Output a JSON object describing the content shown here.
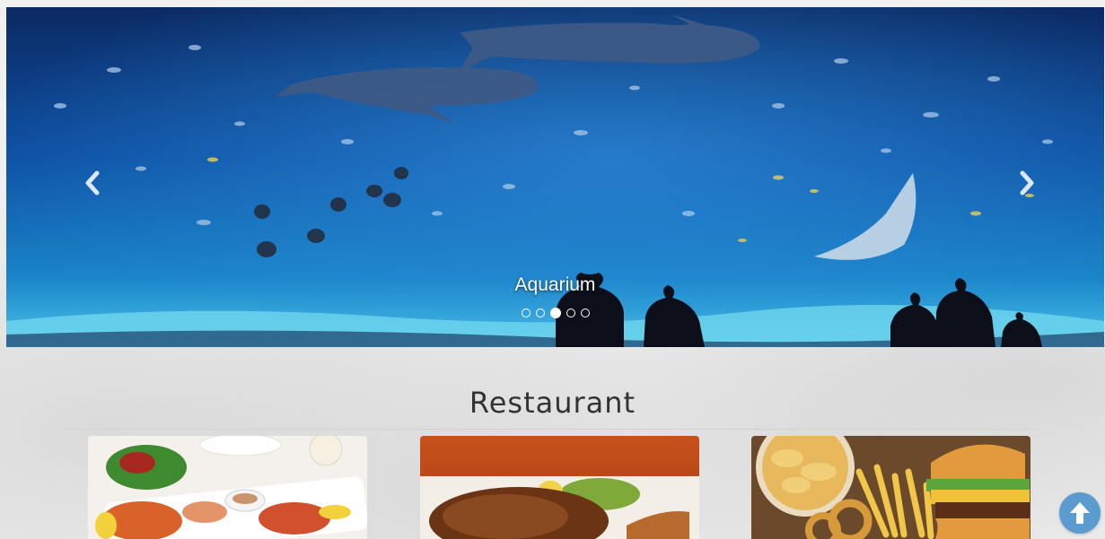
{
  "carousel": {
    "caption": "Aquarium",
    "indicator_count": 5,
    "active_index": 2,
    "prev_icon": "chevron-left-icon",
    "next_icon": "chevron-right-icon"
  },
  "section": {
    "title": "Restaurant"
  },
  "cards": [
    {
      "image": "seafood-platter-image"
    },
    {
      "image": "roast-meat-plate-image"
    },
    {
      "image": "burger-and-fries-image"
    }
  ],
  "back_to_top": {
    "icon": "arrow-up-icon",
    "color": "#5b9bd0"
  },
  "colors": {
    "water_deep": "#0a2f6e",
    "water_light": "#3fb3e0",
    "sand": "#6fd6ee"
  }
}
